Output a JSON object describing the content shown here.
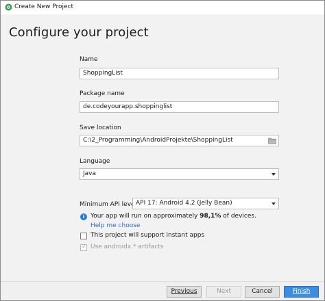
{
  "window": {
    "title": "Create New Project"
  },
  "header": {
    "title": "Configure your project"
  },
  "form": {
    "name": {
      "label": "Name",
      "value": "ShoppingList"
    },
    "package_name": {
      "label": "Package name",
      "value": "de.codeyourapp.shoppinglist"
    },
    "save_location": {
      "label": "Save location",
      "value": "C:\\2_Programming\\AndroidProjekte\\ShoppingList"
    },
    "language": {
      "label": "Language",
      "selected": "Java"
    },
    "min_api": {
      "label": "Minimum API level",
      "selected": "API 17: Android 4.2 (Jelly Bean)"
    },
    "info": {
      "prefix": "Your app will run on approximately ",
      "percent": "98,1%",
      "suffix": " of devices.",
      "help_link": "Help me choose"
    },
    "instant_apps": {
      "label": "This project will support instant apps",
      "checked": false
    },
    "androidx": {
      "label": "Use androidx.* artifacts",
      "checked": true,
      "disabled": true
    }
  },
  "footer": {
    "previous_label": "Previous",
    "next_label": "Next",
    "cancel_label": "Cancel",
    "finish_label": "Finish"
  },
  "colors": {
    "accent": "#3b8de0",
    "link": "#2a6fc9",
    "info": "#2a7bd6"
  }
}
